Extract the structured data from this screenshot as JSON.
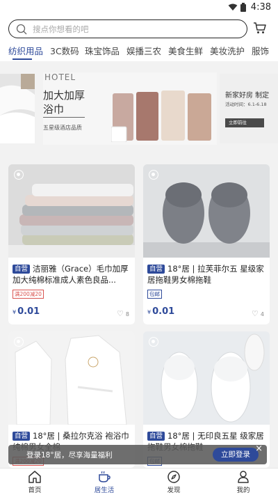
{
  "status_bar": {
    "time": "4:38"
  },
  "search": {
    "placeholder": "搜点你想看的吧"
  },
  "category_tabs": [
    {
      "label": "纺织用品",
      "active": true
    },
    {
      "label": "3C数码"
    },
    {
      "label": "珠宝饰品"
    },
    {
      "label": "娱播三农"
    },
    {
      "label": "美食生鲜"
    },
    {
      "label": "美妆洗护"
    },
    {
      "label": "服饰"
    }
  ],
  "banner": {
    "main": {
      "eyebrow": "HOTEL",
      "line1": "加大加厚",
      "line2": "浴巾",
      "sub": "五星级酒店品质"
    },
    "right": {
      "headline": "新家好房  制定",
      "date": "活动时间：6.1-6.18",
      "button": "立即前往"
    }
  },
  "products": [
    {
      "tag": "自营",
      "title": "洁丽雅（Grace）毛巾加厚加大纯棉标准成人素色良品...",
      "coupon": "满200减20",
      "price_symbol": "¥",
      "price": "0.01",
      "likes": "8"
    },
    {
      "tag": "自营",
      "title": "18°居 | 拉芙菲尔五 星级家居拖鞋男女棉拖鞋",
      "coupon": "包邮",
      "price_symbol": "¥",
      "price": "0.01",
      "likes": "4"
    },
    {
      "tag": "自营",
      "title": "18°居 | 桑拉尔克浴 袍浴巾纯棉男女全棉",
      "coupon": "满200减20"
    },
    {
      "tag": "自营",
      "title": "18°居 | 无印良五星 级家居拖鞋男女棉拖鞋",
      "coupon": "包邮"
    }
  ],
  "toast": {
    "message": "登录18°居，尽享海量福利",
    "button": "立即登录",
    "close": "×"
  },
  "bottom_nav": [
    {
      "label": "首页",
      "icon": "home-icon"
    },
    {
      "label": "居生活",
      "icon": "cup-icon",
      "active": true
    },
    {
      "label": "发现",
      "icon": "compass-icon"
    },
    {
      "label": "我的",
      "icon": "user-icon"
    }
  ],
  "colors": {
    "accent": "#2e4a9a",
    "coupon_red": "#d9534f",
    "background": "#f2f2f2"
  }
}
